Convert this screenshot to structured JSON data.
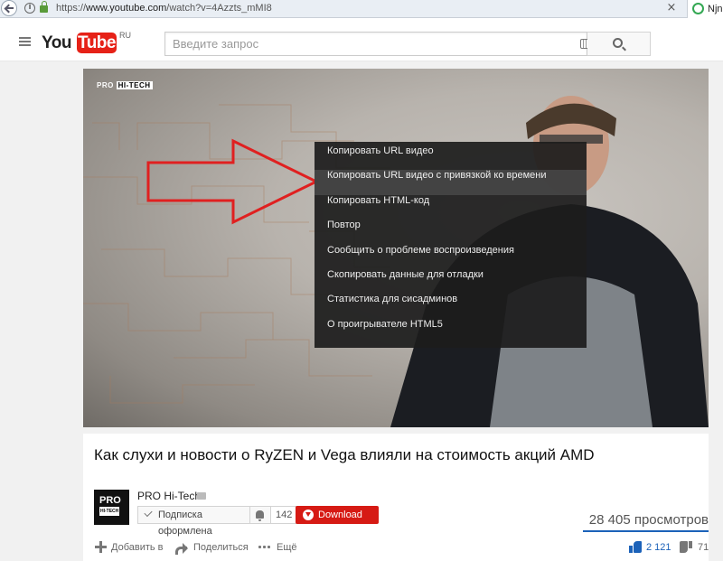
{
  "browser": {
    "url_prefix": "https://",
    "url_host": "www.youtube.com",
    "url_path": "/watch?v=4Azzts_mMI8",
    "close_glyph": "×",
    "profile_name": "Njn"
  },
  "header": {
    "logo_you": "You",
    "logo_tube": "Tube",
    "logo_region": "RU",
    "search_placeholder": "Введите запрос"
  },
  "player": {
    "watermark_a": "PRO",
    "watermark_b": "HI-TECH",
    "context_menu": [
      "Копировать URL видео",
      "Копировать URL видео с привязкой ко времени",
      "Копировать HTML-код",
      "Повтор",
      "Сообщить о проблеме воспроизведения",
      "Скопировать данные для отладки",
      "Статистика для сисадминов",
      "О проигрывателе HTML5"
    ],
    "arrow_color": "#e02020"
  },
  "video": {
    "title": "Как слухи и новости о RyZEN и Vega влияли на стоимость акций AMD",
    "avatar_text": "PRO",
    "avatar_sub": "HI-TECH",
    "channel_name": "PRO Hi-Tech",
    "subscribe_label": "Подписка оформлена",
    "subscriber_count": "142 5",
    "download_label": "Download",
    "views": "28 405 просмотров",
    "add_to_label": "Добавить в",
    "share_label": "Поделиться",
    "more_label": "Ещё",
    "likes": "2 121",
    "dislikes": "71"
  },
  "colors": {
    "accent_red": "#e62117",
    "like_blue": "#1c62b9"
  }
}
